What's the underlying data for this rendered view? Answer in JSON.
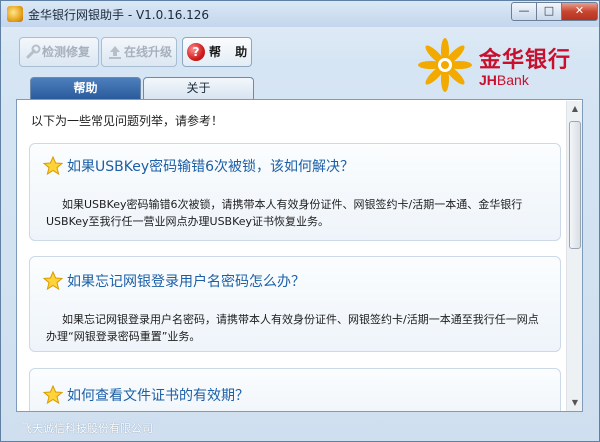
{
  "window": {
    "title": "金华银行网银助手 - V1.0.16.126",
    "controls": {
      "minimize": "—",
      "maximize": "□",
      "close": "✕"
    }
  },
  "toolbar": {
    "repair_label": "检测修复",
    "upgrade_label": "在线升级",
    "help_label": "帮 助",
    "help_icon_glyph": "?"
  },
  "logo": {
    "name_cn": "金华银行",
    "name_en_bold": "JH",
    "name_en_thin": "Bank",
    "brand_color": "#c8102e",
    "star_color": "#f2a900"
  },
  "tabs": [
    {
      "label": "帮助",
      "active": true
    },
    {
      "label": "关于",
      "active": false
    }
  ],
  "content": {
    "intro": "以下为一些常见问题列举，请参考！",
    "faqs": [
      {
        "question": "如果USBKey密码输错6次被锁，该如何解决？",
        "answer": "如果USBKey密码输错6次被锁，请携带本人有效身份证件、网银签约卡/活期一本通、金华银行USBKey至我行任一营业网点办理USBKey证书恢复业务。"
      },
      {
        "question": "如果忘记网银登录用户名密码怎么办？",
        "answer": "如果忘记网银登录用户名密码，请携带本人有效身份证件、网银签约卡/活期一本通至我行任一网点办理“网银登录密码重置”业务。"
      },
      {
        "question": "如何查看文件证书的有效期？",
        "answer": ""
      }
    ]
  },
  "footer": "飞天诚信科技股份有限公司",
  "colors": {
    "accent_tab": "#2a5b9c",
    "question_text": "#1c5fa6",
    "help_button_red": "#d01c1c"
  }
}
